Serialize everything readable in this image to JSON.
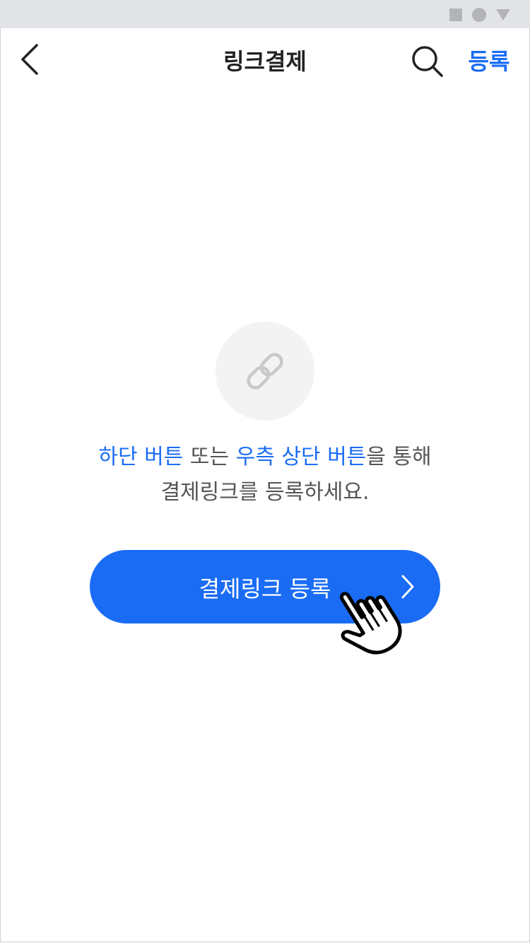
{
  "header": {
    "title": "링크결제",
    "register_label": "등록",
    "accent_color": "#1a6cf5"
  },
  "icons": {
    "back": "chevron-left-icon",
    "search": "search-icon",
    "empty": "link-icon",
    "cta_arrow": "chevron-right-icon",
    "pointer": "hand-pointer-icon"
  },
  "empty_state": {
    "line1": {
      "hl1": "하단 버튼",
      "t1": " 또는 ",
      "hl2": "우측 상단 버튼",
      "t2": "을 통해"
    },
    "line2": "결제링크를 등록하세요."
  },
  "cta": {
    "label": "결제링크 등록",
    "color": "#1a6cf5"
  }
}
